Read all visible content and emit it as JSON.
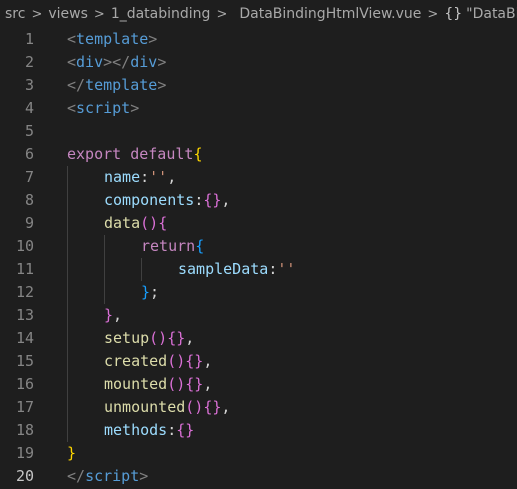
{
  "breadcrumb": {
    "items": [
      "src",
      "views",
      "1_databinding",
      "DataBindingHtmlView.vue",
      "\"DataBi"
    ],
    "separator": ">",
    "vue_icon": "vue-logo-icon",
    "object_icon": "{}"
  },
  "colors": {
    "background": "#1e1e1e",
    "line_number": "#858585",
    "line_number_active": "#c6c6c6",
    "tag_bracket": "#808080",
    "tag_name": "#569cd6",
    "keyword": "#c586c0",
    "property": "#9cdcfe",
    "string": "#ce9178",
    "function": "#dcdcaa",
    "vue_green": "#41b883"
  },
  "editor": {
    "active_line": 20,
    "lines": [
      {
        "n": "1",
        "tokens": [
          {
            "t": "<",
            "c": "tag"
          },
          {
            "t": "template",
            "c": "tagname"
          },
          {
            "t": ">",
            "c": "tag"
          }
        ]
      },
      {
        "n": "2",
        "tokens": [
          {
            "t": "<",
            "c": "tag"
          },
          {
            "t": "div",
            "c": "tagname"
          },
          {
            "t": "></",
            "c": "tag"
          },
          {
            "t": "div",
            "c": "tagname"
          },
          {
            "t": ">",
            "c": "tag"
          }
        ]
      },
      {
        "n": "3",
        "tokens": [
          {
            "t": "</",
            "c": "tag"
          },
          {
            "t": "template",
            "c": "tagname"
          },
          {
            "t": ">",
            "c": "tag"
          }
        ]
      },
      {
        "n": "4",
        "tokens": [
          {
            "t": "<",
            "c": "tag"
          },
          {
            "t": "script",
            "c": "tagname"
          },
          {
            "t": ">",
            "c": "tag"
          }
        ]
      },
      {
        "n": "5",
        "tokens": []
      },
      {
        "n": "6",
        "tokens": [
          {
            "t": "export",
            "c": "kw"
          },
          {
            "t": " ",
            "c": "punc"
          },
          {
            "t": "default",
            "c": "kw"
          },
          {
            "t": "{",
            "c": "b1"
          }
        ]
      },
      {
        "n": "7",
        "indent": 1,
        "tokens": [
          {
            "t": "name",
            "c": "prop"
          },
          {
            "t": ":",
            "c": "punc"
          },
          {
            "t": "''",
            "c": "str"
          },
          {
            "t": ",",
            "c": "punc"
          }
        ]
      },
      {
        "n": "8",
        "indent": 1,
        "tokens": [
          {
            "t": "components",
            "c": "prop"
          },
          {
            "t": ":",
            "c": "punc"
          },
          {
            "t": "{}",
            "c": "b2"
          },
          {
            "t": ",",
            "c": "punc"
          }
        ]
      },
      {
        "n": "9",
        "indent": 1,
        "tokens": [
          {
            "t": "data",
            "c": "fn"
          },
          {
            "t": "()",
            "c": "b2"
          },
          {
            "t": "{",
            "c": "b2"
          }
        ]
      },
      {
        "n": "10",
        "indent": 2,
        "tokens": [
          {
            "t": "return",
            "c": "kw"
          },
          {
            "t": "{",
            "c": "b3"
          }
        ]
      },
      {
        "n": "11",
        "indent": 3,
        "tokens": [
          {
            "t": "sampleData",
            "c": "prop"
          },
          {
            "t": ":",
            "c": "punc"
          },
          {
            "t": "''",
            "c": "str"
          }
        ]
      },
      {
        "n": "12",
        "indent": 2,
        "tokens": [
          {
            "t": "}",
            "c": "b3"
          },
          {
            "t": ";",
            "c": "punc"
          }
        ]
      },
      {
        "n": "13",
        "indent": 1,
        "tokens": [
          {
            "t": "}",
            "c": "b2"
          },
          {
            "t": ",",
            "c": "punc"
          }
        ]
      },
      {
        "n": "14",
        "indent": 1,
        "tokens": [
          {
            "t": "setup",
            "c": "fn"
          },
          {
            "t": "()",
            "c": "b2"
          },
          {
            "t": "{}",
            "c": "b2"
          },
          {
            "t": ",",
            "c": "punc"
          }
        ]
      },
      {
        "n": "15",
        "indent": 1,
        "tokens": [
          {
            "t": "created",
            "c": "fn"
          },
          {
            "t": "()",
            "c": "b2"
          },
          {
            "t": "{}",
            "c": "b2"
          },
          {
            "t": ",",
            "c": "punc"
          }
        ]
      },
      {
        "n": "16",
        "indent": 1,
        "tokens": [
          {
            "t": "mounted",
            "c": "fn"
          },
          {
            "t": "()",
            "c": "b2"
          },
          {
            "t": "{}",
            "c": "b2"
          },
          {
            "t": ",",
            "c": "punc"
          }
        ]
      },
      {
        "n": "17",
        "indent": 1,
        "tokens": [
          {
            "t": "unmounted",
            "c": "fn"
          },
          {
            "t": "()",
            "c": "b2"
          },
          {
            "t": "{}",
            "c": "b2"
          },
          {
            "t": ",",
            "c": "punc"
          }
        ]
      },
      {
        "n": "18",
        "indent": 1,
        "tokens": [
          {
            "t": "methods",
            "c": "prop"
          },
          {
            "t": ":",
            "c": "punc"
          },
          {
            "t": "{}",
            "c": "b2"
          }
        ]
      },
      {
        "n": "19",
        "tokens": [
          {
            "t": "}",
            "c": "b1"
          }
        ]
      },
      {
        "n": "20",
        "tokens": [
          {
            "t": "</",
            "c": "tag"
          },
          {
            "t": "script",
            "c": "tagname"
          },
          {
            "t": ">",
            "c": "tag"
          }
        ]
      }
    ]
  }
}
